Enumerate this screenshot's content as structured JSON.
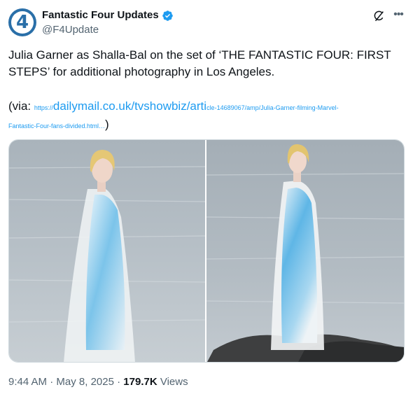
{
  "tweet": {
    "display_name": "Fantastic Four Updates",
    "handle": "@F4Update",
    "avatar_glyph": "4",
    "text": "Julia Garner as Shalla-Bal on the set of ‘THE FANTASTIC FOUR: FIRST STEPS’ for additional photography in Los Angeles.",
    "via_prefix": "(via: ",
    "link": {
      "scheme": "https://",
      "main": "dailymail.co.uk/tvshowbiz/arti",
      "rest1": "cle-14689067/amp/Julia-Garner-filming-Marvel-",
      "rest2": "Fantastic-Four-fans-divided.html",
      "ellipsis": "…"
    },
    "via_suffix": ")",
    "time": "9:44 AM",
    "sep1": " · ",
    "date": "May 8, 2025",
    "sep2": " · ",
    "views_count": "179.7K",
    "views_label": " Views"
  },
  "icons": {
    "verified": "verified-badge-icon",
    "grok": "grok-icon",
    "more": "more-options-icon"
  },
  "colors": {
    "link": "#1d9bf0",
    "verified": "#1d9bf0",
    "muted": "#536471",
    "avatar": "#2a6fa8"
  }
}
